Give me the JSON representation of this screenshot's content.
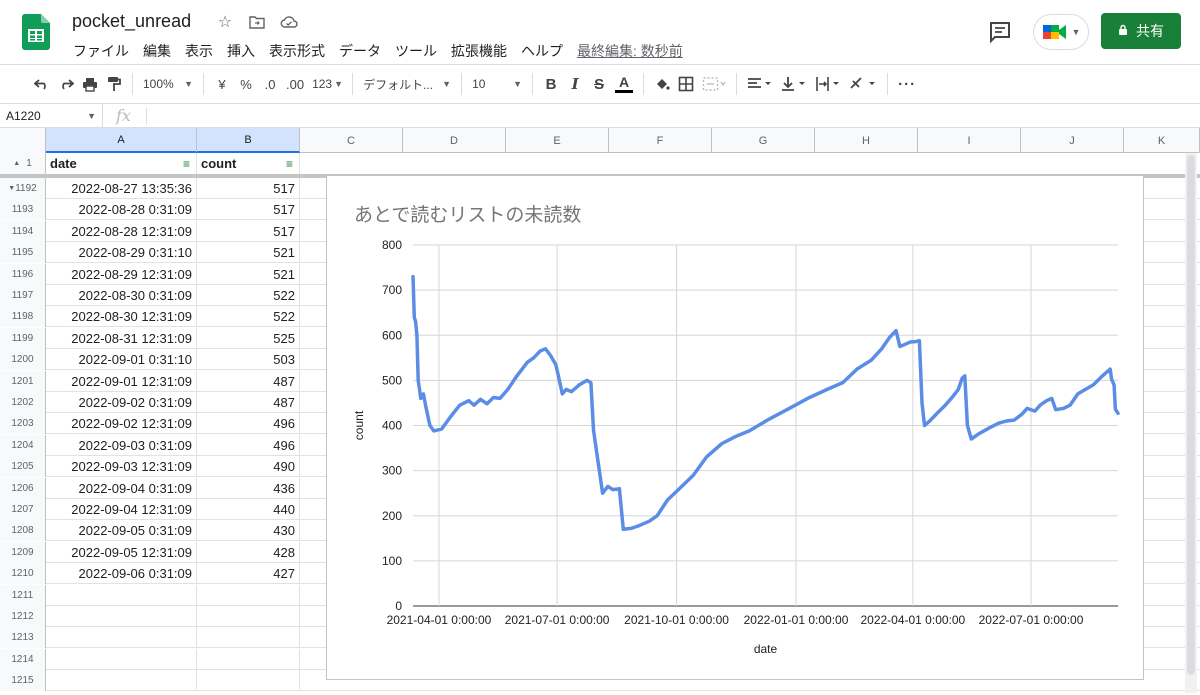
{
  "app": {
    "title": "pocket_unread",
    "menu": [
      "ファイル",
      "編集",
      "表示",
      "挿入",
      "表示形式",
      "データ",
      "ツール",
      "拡張機能",
      "ヘルプ"
    ],
    "last_edit": "最終編集: 数秒前",
    "share_label": "共有",
    "brand_color": "#188038"
  },
  "toolbar": {
    "zoom": "100%",
    "currency": "¥",
    "percent": "%",
    "dec_less": ".0",
    "dec_more": ".00",
    "format": "123",
    "font": "デフォルト...",
    "font_size": "10"
  },
  "formula_bar": {
    "cell_ref": "A1220",
    "fx": "fx",
    "value": ""
  },
  "sheet": {
    "columns": [
      "A",
      "B",
      "C",
      "D",
      "E",
      "F",
      "G",
      "H",
      "I",
      "J",
      "K"
    ],
    "header_row_number": "1",
    "headers": [
      "date",
      "count"
    ],
    "rows": [
      {
        "n": "1192",
        "date": "2022-08-27 13:35:36",
        "count": "517"
      },
      {
        "n": "1193",
        "date": "2022-08-28 0:31:09",
        "count": "517"
      },
      {
        "n": "1194",
        "date": "2022-08-28 12:31:09",
        "count": "517"
      },
      {
        "n": "1195",
        "date": "2022-08-29 0:31:10",
        "count": "521"
      },
      {
        "n": "1196",
        "date": "2022-08-29 12:31:09",
        "count": "521"
      },
      {
        "n": "1197",
        "date": "2022-08-30 0:31:09",
        "count": "522"
      },
      {
        "n": "1198",
        "date": "2022-08-30 12:31:09",
        "count": "522"
      },
      {
        "n": "1199",
        "date": "2022-08-31 12:31:09",
        "count": "525"
      },
      {
        "n": "1200",
        "date": "2022-09-01 0:31:10",
        "count": "503"
      },
      {
        "n": "1201",
        "date": "2022-09-01 12:31:09",
        "count": "487"
      },
      {
        "n": "1202",
        "date": "2022-09-02 0:31:09",
        "count": "487"
      },
      {
        "n": "1203",
        "date": "2022-09-02 12:31:09",
        "count": "496"
      },
      {
        "n": "1204",
        "date": "2022-09-03 0:31:09",
        "count": "496"
      },
      {
        "n": "1205",
        "date": "2022-09-03 12:31:09",
        "count": "490"
      },
      {
        "n": "1206",
        "date": "2022-09-04 0:31:09",
        "count": "436"
      },
      {
        "n": "1207",
        "date": "2022-09-04 12:31:09",
        "count": "440"
      },
      {
        "n": "1208",
        "date": "2022-09-05 0:31:09",
        "count": "430"
      },
      {
        "n": "1209",
        "date": "2022-09-05 12:31:09",
        "count": "428"
      },
      {
        "n": "1210",
        "date": "2022-09-06 0:31:09",
        "count": "427"
      },
      {
        "n": "1211",
        "date": "",
        "count": ""
      },
      {
        "n": "1212",
        "date": "",
        "count": ""
      },
      {
        "n": "1213",
        "date": "",
        "count": ""
      },
      {
        "n": "1214",
        "date": "",
        "count": ""
      },
      {
        "n": "1215",
        "date": "",
        "count": ""
      }
    ]
  },
  "chart_data": {
    "type": "line",
    "title": "あとで読むリストの未読数",
    "xlabel": "date",
    "ylabel": "count",
    "ylim": [
      0,
      800
    ],
    "y_ticks": [
      "0",
      "100",
      "200",
      "300",
      "400",
      "500",
      "600",
      "700",
      "800"
    ],
    "x_tick_labels": [
      "2021-04-01 0:00:00",
      "2021-07-01 0:00:00",
      "2021-10-01 0:00:00",
      "2022-01-01 0:00:00",
      "2022-04-01 0:00:00",
      "2022-07-01 0:00:00"
    ],
    "x_ticks_date": [
      "2021-04-01",
      "2021-07-01",
      "2021-10-01",
      "2022-01-01",
      "2022-04-01",
      "2022-07-01"
    ],
    "xlim_date": [
      "2021-03-12",
      "2022-09-06"
    ],
    "grid": true,
    "line_color": "#5b8de6",
    "series": [
      {
        "points": [
          [
            "2021-03-12",
            730
          ],
          [
            "2021-03-13",
            640
          ],
          [
            "2021-03-14",
            630
          ],
          [
            "2021-03-15",
            600
          ],
          [
            "2021-03-16",
            500
          ],
          [
            "2021-03-18",
            460
          ],
          [
            "2021-03-20",
            470
          ],
          [
            "2021-03-22",
            440
          ],
          [
            "2021-03-25",
            400
          ],
          [
            "2021-03-28",
            388
          ],
          [
            "2021-04-03",
            392
          ],
          [
            "2021-04-10",
            420
          ],
          [
            "2021-04-17",
            445
          ],
          [
            "2021-04-24",
            455
          ],
          [
            "2021-04-28",
            445
          ],
          [
            "2021-05-03",
            458
          ],
          [
            "2021-05-08",
            448
          ],
          [
            "2021-05-13",
            462
          ],
          [
            "2021-05-18",
            460
          ],
          [
            "2021-05-24",
            480
          ],
          [
            "2021-05-31",
            510
          ],
          [
            "2021-06-08",
            540
          ],
          [
            "2021-06-13",
            550
          ],
          [
            "2021-06-18",
            565
          ],
          [
            "2021-06-22",
            570
          ],
          [
            "2021-06-26",
            555
          ],
          [
            "2021-06-30",
            535
          ],
          [
            "2021-07-02",
            510
          ],
          [
            "2021-07-05",
            470
          ],
          [
            "2021-07-08",
            480
          ],
          [
            "2021-07-12",
            475
          ],
          [
            "2021-07-18",
            490
          ],
          [
            "2021-07-24",
            500
          ],
          [
            "2021-07-27",
            495
          ],
          [
            "2021-07-29",
            390
          ],
          [
            "2021-08-01",
            330
          ],
          [
            "2021-08-05",
            250
          ],
          [
            "2021-08-09",
            265
          ],
          [
            "2021-08-13",
            258
          ],
          [
            "2021-08-18",
            260
          ],
          [
            "2021-08-21",
            170
          ],
          [
            "2021-08-27",
            172
          ],
          [
            "2021-09-02",
            178
          ],
          [
            "2021-09-10",
            188
          ],
          [
            "2021-09-16",
            200
          ],
          [
            "2021-09-24",
            235
          ],
          [
            "2021-10-05",
            265
          ],
          [
            "2021-10-14",
            290
          ],
          [
            "2021-10-24",
            330
          ],
          [
            "2021-11-05",
            360
          ],
          [
            "2021-11-15",
            375
          ],
          [
            "2021-11-26",
            388
          ],
          [
            "2021-12-10",
            412
          ],
          [
            "2021-12-25",
            435
          ],
          [
            "2022-01-10",
            460
          ],
          [
            "2022-01-25",
            480
          ],
          [
            "2022-02-06",
            495
          ],
          [
            "2022-02-17",
            525
          ],
          [
            "2022-02-28",
            545
          ],
          [
            "2022-03-08",
            570
          ],
          [
            "2022-03-14",
            595
          ],
          [
            "2022-03-19",
            610
          ],
          [
            "2022-03-22",
            575
          ],
          [
            "2022-03-26",
            580
          ],
          [
            "2022-03-30",
            585
          ],
          [
            "2022-04-03",
            586
          ],
          [
            "2022-04-06",
            588
          ],
          [
            "2022-04-08",
            450
          ],
          [
            "2022-04-10",
            400
          ],
          [
            "2022-04-14",
            410
          ],
          [
            "2022-04-20",
            428
          ],
          [
            "2022-04-26",
            445
          ],
          [
            "2022-05-02",
            465
          ],
          [
            "2022-05-06",
            480
          ],
          [
            "2022-05-09",
            505
          ],
          [
            "2022-05-11",
            510
          ],
          [
            "2022-05-13",
            400
          ],
          [
            "2022-05-16",
            370
          ],
          [
            "2022-05-22",
            382
          ],
          [
            "2022-05-30",
            395
          ],
          [
            "2022-06-06",
            405
          ],
          [
            "2022-06-12",
            410
          ],
          [
            "2022-06-18",
            412
          ],
          [
            "2022-06-24",
            425
          ],
          [
            "2022-06-28",
            438
          ],
          [
            "2022-07-04",
            432
          ],
          [
            "2022-07-08",
            445
          ],
          [
            "2022-07-13",
            455
          ],
          [
            "2022-07-17",
            460
          ],
          [
            "2022-07-20",
            435
          ],
          [
            "2022-07-26",
            438
          ],
          [
            "2022-07-31",
            445
          ],
          [
            "2022-08-06",
            470
          ],
          [
            "2022-08-12",
            480
          ],
          [
            "2022-08-18",
            490
          ],
          [
            "2022-08-25",
            510
          ],
          [
            "2022-08-31",
            525
          ],
          [
            "2022-09-01",
            503
          ],
          [
            "2022-09-03",
            490
          ],
          [
            "2022-09-04",
            436
          ],
          [
            "2022-09-06",
            427
          ]
        ]
      }
    ]
  }
}
